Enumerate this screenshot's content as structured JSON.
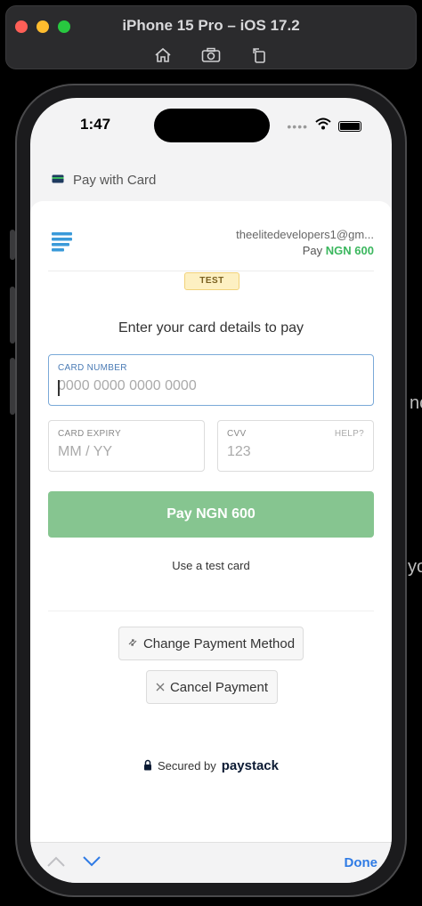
{
  "simulator": {
    "title": "iPhone 15 Pro – iOS 17.2",
    "tools": [
      "home-icon",
      "screenshot-icon",
      "rotate-icon"
    ]
  },
  "background_fragments": [
    "nc",
    "yo"
  ],
  "status_bar": {
    "time": "1:47",
    "dots": "••••"
  },
  "nav": {
    "title": "Pay with Card",
    "icon": "card-icon"
  },
  "merchant": {
    "email": "theelitedevelopers1@gm...",
    "pay_prefix": "Pay",
    "amount": "NGN 600"
  },
  "badge": "TEST",
  "instruction": "Enter your card details to pay",
  "card_number": {
    "label": "CARD NUMBER",
    "placeholder": "0000 0000 0000 0000",
    "value": ""
  },
  "card_expiry": {
    "label": "CARD EXPIRY",
    "placeholder": "MM / YY",
    "value": ""
  },
  "cvv": {
    "label": "CVV",
    "help": "HELP?",
    "placeholder": "123",
    "value": ""
  },
  "pay_button": "Pay NGN 600",
  "test_card_link": "Use a test card",
  "change_method": "Change Payment Method",
  "cancel_payment": "Cancel Payment",
  "secured_by": "Secured by",
  "brand": "paystack",
  "toolbar": {
    "done": "Done"
  },
  "colors": {
    "accent_green": "#3bb75e",
    "pay_button": "#86c590",
    "done_blue": "#2f7be5"
  }
}
